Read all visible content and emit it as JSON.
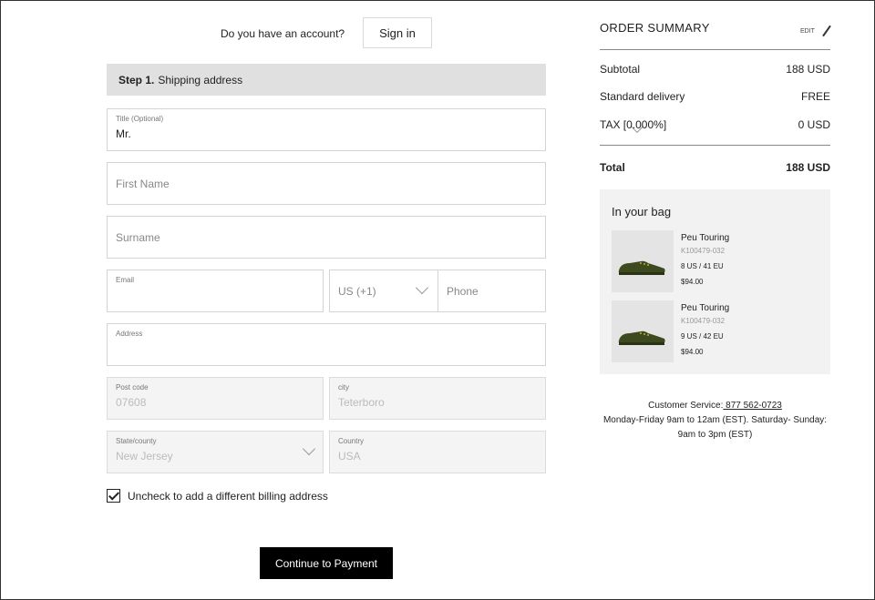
{
  "account": {
    "question": "Do you have an account?",
    "signin_label": "Sign in"
  },
  "step": {
    "number": "Step 1.",
    "title": "Shipping address"
  },
  "form": {
    "title": {
      "label": "Title (Optional)",
      "value": "Mr."
    },
    "first_name": {
      "placeholder": "First Name"
    },
    "surname": {
      "placeholder": "Surname"
    },
    "email": {
      "label": "Email",
      "value": ""
    },
    "country_code": {
      "value": "US (+1)"
    },
    "phone": {
      "placeholder": "Phone"
    },
    "address": {
      "label": "Address",
      "value": ""
    },
    "post_code": {
      "label": "Post code",
      "value": "07608"
    },
    "city": {
      "label": "city",
      "value": "Teterboro"
    },
    "state": {
      "label": "State/county",
      "value": "New Jersey"
    },
    "country": {
      "label": "Country",
      "value": "USA"
    },
    "billing_checkbox": {
      "label": "Uncheck to add a different billing address",
      "checked": true
    },
    "continue_label": "Continue to Payment"
  },
  "summary": {
    "title": "ORDER SUMMARY",
    "edit_label": "EDIT",
    "rows": [
      {
        "label": "Subtotal",
        "value": "188 USD"
      },
      {
        "label": "Standard delivery",
        "value": "FREE"
      },
      {
        "label": "TAX [0.000%]",
        "value": "0 USD"
      }
    ],
    "total": {
      "label": "Total",
      "value": "188 USD"
    }
  },
  "bag": {
    "title": "In your bag",
    "items": [
      {
        "name": "Peu Touring",
        "sku": "K100479-032",
        "size": "8 US / 41 EU",
        "price": "$94.00"
      },
      {
        "name": "Peu Touring",
        "sku": "K100479-032",
        "size": "9 US / 42 EU",
        "price": "$94.00"
      }
    ]
  },
  "customer_service": {
    "label": "Customer Service:",
    "phone": " 877 562-0723",
    "hours": "Monday-Friday 9am to 12am (EST). Saturday- Sunday: 9am to 3pm (EST)"
  },
  "colors": {
    "button_bg": "#000000",
    "step_bg": "#e0e0e0",
    "bag_bg": "#f2f2f2",
    "shoe": "#3d4a1f"
  },
  "icons": [
    "chevron-down-icon",
    "check-icon",
    "pencil-icon"
  ]
}
